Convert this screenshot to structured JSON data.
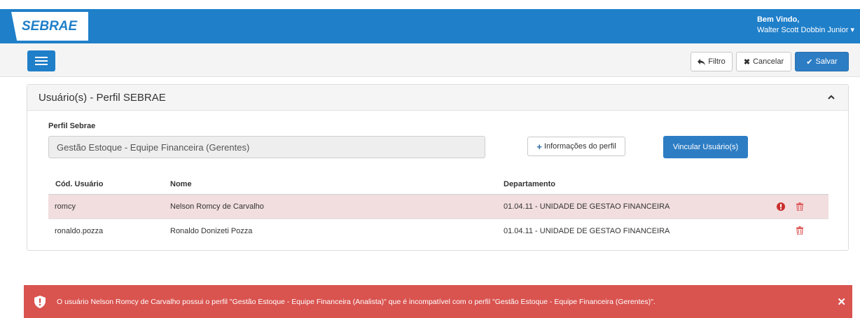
{
  "header": {
    "logo_text": "SEBRAE",
    "welcome": "Bem Vindo,",
    "user_name": "Walter Scott Dobbin Junior ▾"
  },
  "toolbar": {
    "filter_label": "Filtro",
    "cancel_label": "Cancelar",
    "save_label": "Salvar"
  },
  "panel": {
    "title": "Usuário(s) - Perfil SEBRAE",
    "profile_label": "Perfil Sebrae",
    "profile_value": "Gestão Estoque - Equipe Financeira (Gerentes)",
    "info_button": "Informações do perfil",
    "link_button": "Vincular Usuário(s)"
  },
  "table": {
    "headers": [
      "Cód. Usuário",
      "Nome",
      "Departamento"
    ],
    "rows": [
      {
        "code": "romcy",
        "name": "Nelson Romcy de Carvalho",
        "dept": "01.04.11 - UNIDADE DE GESTAO FINANCEIRA",
        "error": true
      },
      {
        "code": "ronaldo.pozza",
        "name": "Ronaldo Donizeti Pozza",
        "dept": "01.04.11 - UNIDADE DE GESTAO FINANCEIRA",
        "error": false
      }
    ]
  },
  "alert": {
    "message": "O usuário Nelson Romcy de Carvalho possui o perfil \"Gestão Estoque - Equipe Financeira (Analista)\" que é incompatível com o perfil \"Gestão Estoque - Equipe Financeira (Gerentes)\".",
    "close": "✕"
  },
  "colors": {
    "brand_blue": "#1f7fc9",
    "error_row": "#f2dedf",
    "danger": "#d9534f",
    "error_icon": "#c9302c"
  }
}
